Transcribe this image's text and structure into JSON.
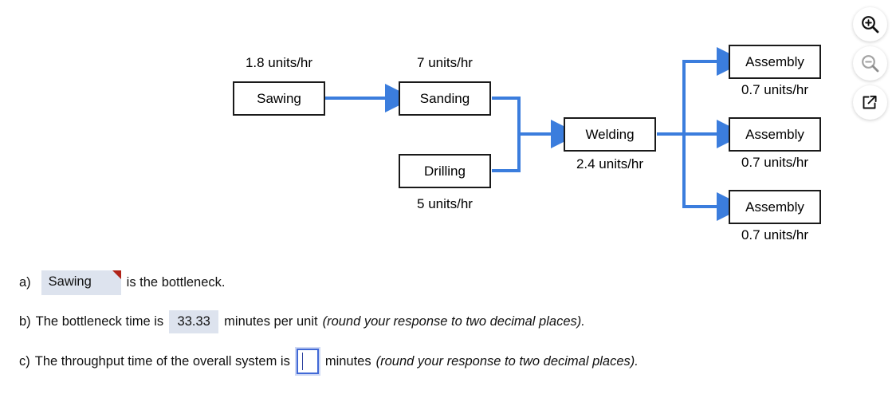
{
  "diagram": {
    "type": "process-flow",
    "nodes": [
      {
        "id": "sawing",
        "label": "Sawing",
        "rate": "1.8 units/hr",
        "rate_position": "above"
      },
      {
        "id": "sanding",
        "label": "Sanding",
        "rate": "7 units/hr",
        "rate_position": "above"
      },
      {
        "id": "drilling",
        "label": "Drilling",
        "rate": "5 units/hr",
        "rate_position": "below"
      },
      {
        "id": "welding",
        "label": "Welding",
        "rate": "2.4 units/hr",
        "rate_position": "below"
      },
      {
        "id": "assembly1",
        "label": "Assembly",
        "rate": "0.7 units/hr",
        "rate_position": "below"
      },
      {
        "id": "assembly2",
        "label": "Assembly",
        "rate": "0.7 units/hr",
        "rate_position": "below"
      },
      {
        "id": "assembly3",
        "label": "Assembly",
        "rate": "0.7 units/hr",
        "rate_position": "below"
      }
    ],
    "edges": [
      {
        "from": "sawing",
        "to": "sanding"
      },
      {
        "from": "sanding",
        "to": "welding"
      },
      {
        "from": "drilling",
        "to": "welding"
      },
      {
        "from": "welding",
        "to": "assembly1"
      },
      {
        "from": "welding",
        "to": "assembly2"
      },
      {
        "from": "welding",
        "to": "assembly3"
      }
    ],
    "arrow_color": "#3b7ddd",
    "box_border_color": "#1a1a1a"
  },
  "questions": {
    "a": {
      "prefix": "a)",
      "answer": "Sawing",
      "text_after": "is the bottleneck.",
      "flagged": true
    },
    "b": {
      "prefix": "b)",
      "text_before": "The bottleneck time is",
      "answer": "33.33",
      "text_after": "minutes per unit",
      "note": "(round your response to two decimal places)."
    },
    "c": {
      "prefix": "c)",
      "text_before": "The throughput time of the overall system is",
      "answer": "",
      "text_after": "minutes",
      "note": "(round your response to two decimal places)."
    }
  },
  "tools": [
    {
      "id": "zoom-in",
      "label": "Zoom In",
      "enabled": true
    },
    {
      "id": "zoom-out",
      "label": "Zoom Out",
      "enabled": false
    },
    {
      "id": "pop-out",
      "label": "Open in new window",
      "enabled": true
    }
  ],
  "colors": {
    "arrow_blue": "#3b7ddd",
    "answer_field_bg": "#dde3ee",
    "flag_red": "#b02318",
    "input_border_blue": "#4169d6"
  }
}
